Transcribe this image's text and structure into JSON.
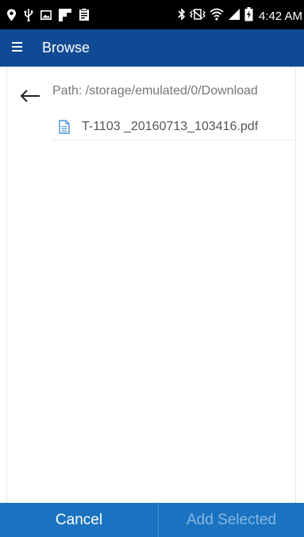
{
  "status_bar": {
    "time": "4:42 AM",
    "left_icons": [
      "location-icon",
      "usb-icon",
      "image-icon",
      "flipboard-icon",
      "clipboard-icon"
    ],
    "right_icons": [
      "bluetooth-icon",
      "vibrate-icon",
      "wifi-icon",
      "signal-icon",
      "battery-charging-icon"
    ]
  },
  "toolbar": {
    "title": "Browse",
    "menu_icon": "hamburger-menu-icon"
  },
  "browser": {
    "path": "Path: /storage/emulated/0/Download",
    "back_icon": "back-arrow-icon",
    "files": [
      {
        "name": "T-1103 _20160713_103416.pdf",
        "icon": "document-icon"
      }
    ]
  },
  "actions": {
    "cancel_label": "Cancel",
    "add_selected_label": "Add Selected"
  },
  "colors": {
    "toolbar": "#114a94",
    "bottom_bar": "#1a73c0",
    "disabled_text": "#86b7e3",
    "file_icon": "#4a90d9"
  }
}
